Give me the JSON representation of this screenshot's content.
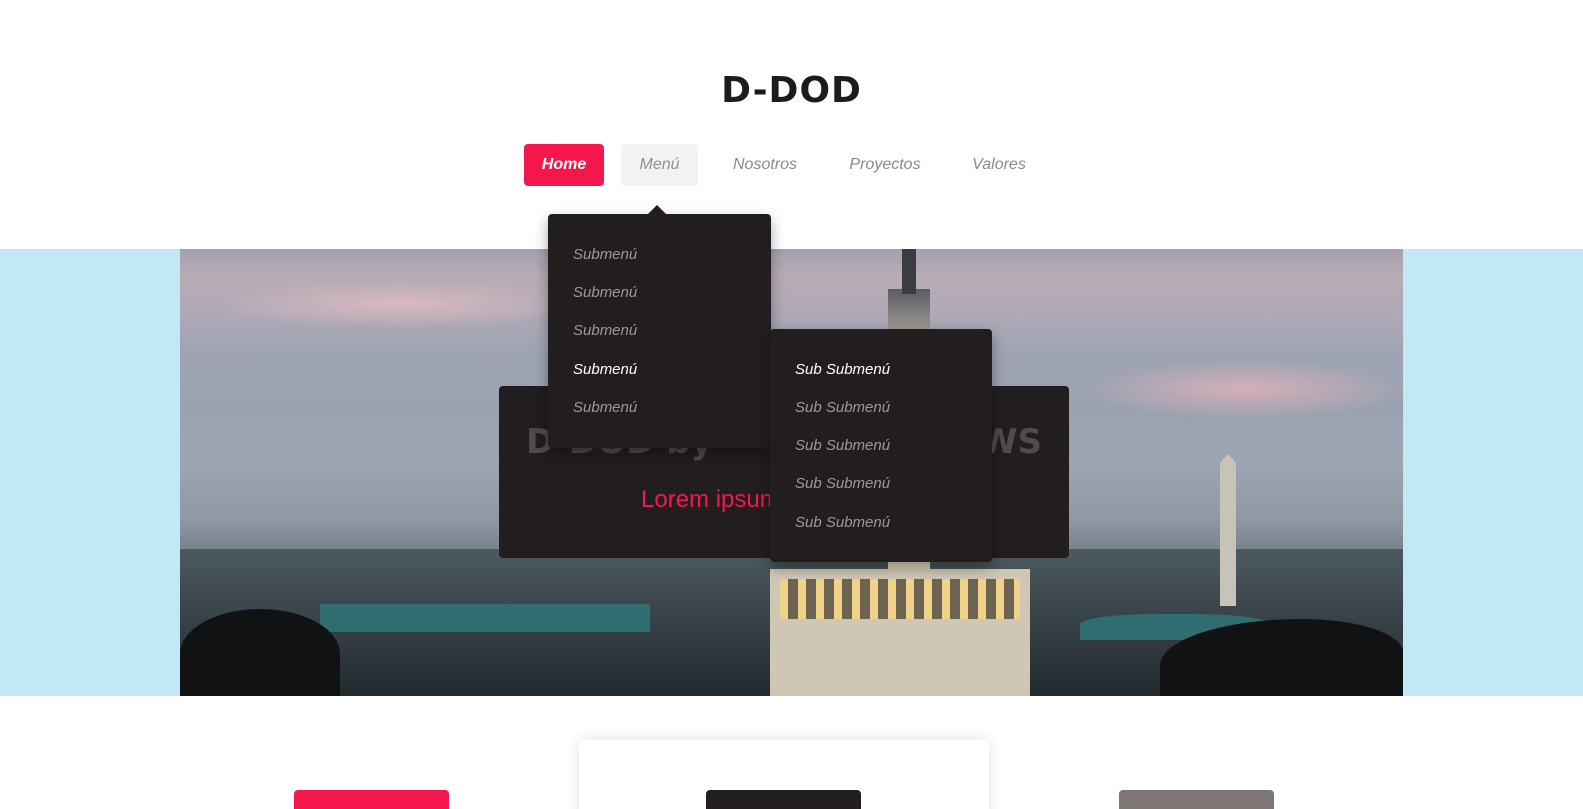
{
  "header": {
    "logo": "D-DOD"
  },
  "nav": {
    "items": [
      {
        "label": "Home"
      },
      {
        "label": "Menú"
      },
      {
        "label": "Nosotros"
      },
      {
        "label": "Proyectos"
      },
      {
        "label": "Valores"
      }
    ]
  },
  "submenu": {
    "items": [
      {
        "label": "Submenú"
      },
      {
        "label": "Submenú"
      },
      {
        "label": "Submenú"
      },
      {
        "label": "Submenú"
      },
      {
        "label": "Submenú"
      }
    ]
  },
  "subsubmenu": {
    "items": [
      {
        "label": "Sub Submenú"
      },
      {
        "label": "Sub Submenú"
      },
      {
        "label": "Sub Submenú"
      },
      {
        "label": "Sub Submenú"
      },
      {
        "label": "Sub Submenú"
      }
    ]
  },
  "hero": {
    "title": "D-DOD by",
    "title_tail": "m WS",
    "subtitle": "Lorem ipsum"
  },
  "colors": {
    "accent": "#f5174c",
    "dark": "#221e1f",
    "band": "#c3e8f5",
    "muted_button": "#7d7674"
  }
}
